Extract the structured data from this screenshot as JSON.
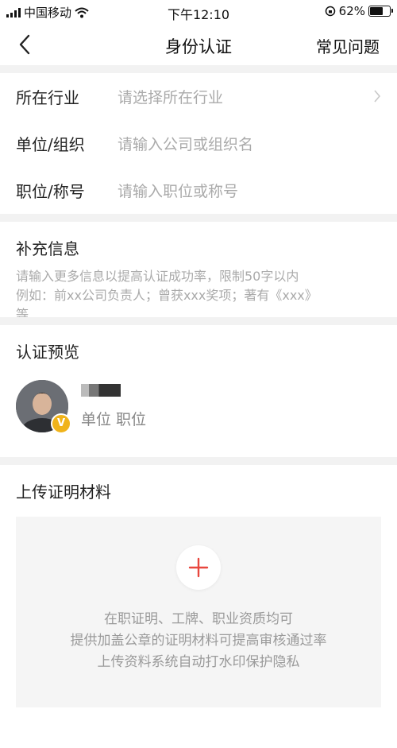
{
  "status_bar": {
    "carrier": "中国移动",
    "time": "下午12:10",
    "battery": "62%",
    "battery_level": 0.62
  },
  "navbar": {
    "title": "身份认证",
    "faq": "常见问题"
  },
  "form": {
    "industry": {
      "label": "所在行业",
      "placeholder": "请选择所在行业"
    },
    "organization": {
      "label": "单位/组织",
      "placeholder": "请输入公司或组织名"
    },
    "position": {
      "label": "职位/称号",
      "placeholder": "请输入职位或称号"
    }
  },
  "supplement": {
    "title": "补充信息",
    "hint_line1": "请输入更多信息以提高认证成功率，限制50字以内",
    "hint_line2": "例如：前xx公司负责人；曾获xxx奖项；著有《xxx》",
    "hint_line3": "等"
  },
  "preview": {
    "title": "认证预览",
    "subtitle": "单位 职位",
    "badge": "V"
  },
  "upload": {
    "title": "上传证明材料",
    "tip1": "在职证明、工牌、职业资质均可",
    "tip2": "提供加盖公章的证明材料可提高审核通过率",
    "tip3": "上传资料系统自动打水印保护隐私"
  }
}
